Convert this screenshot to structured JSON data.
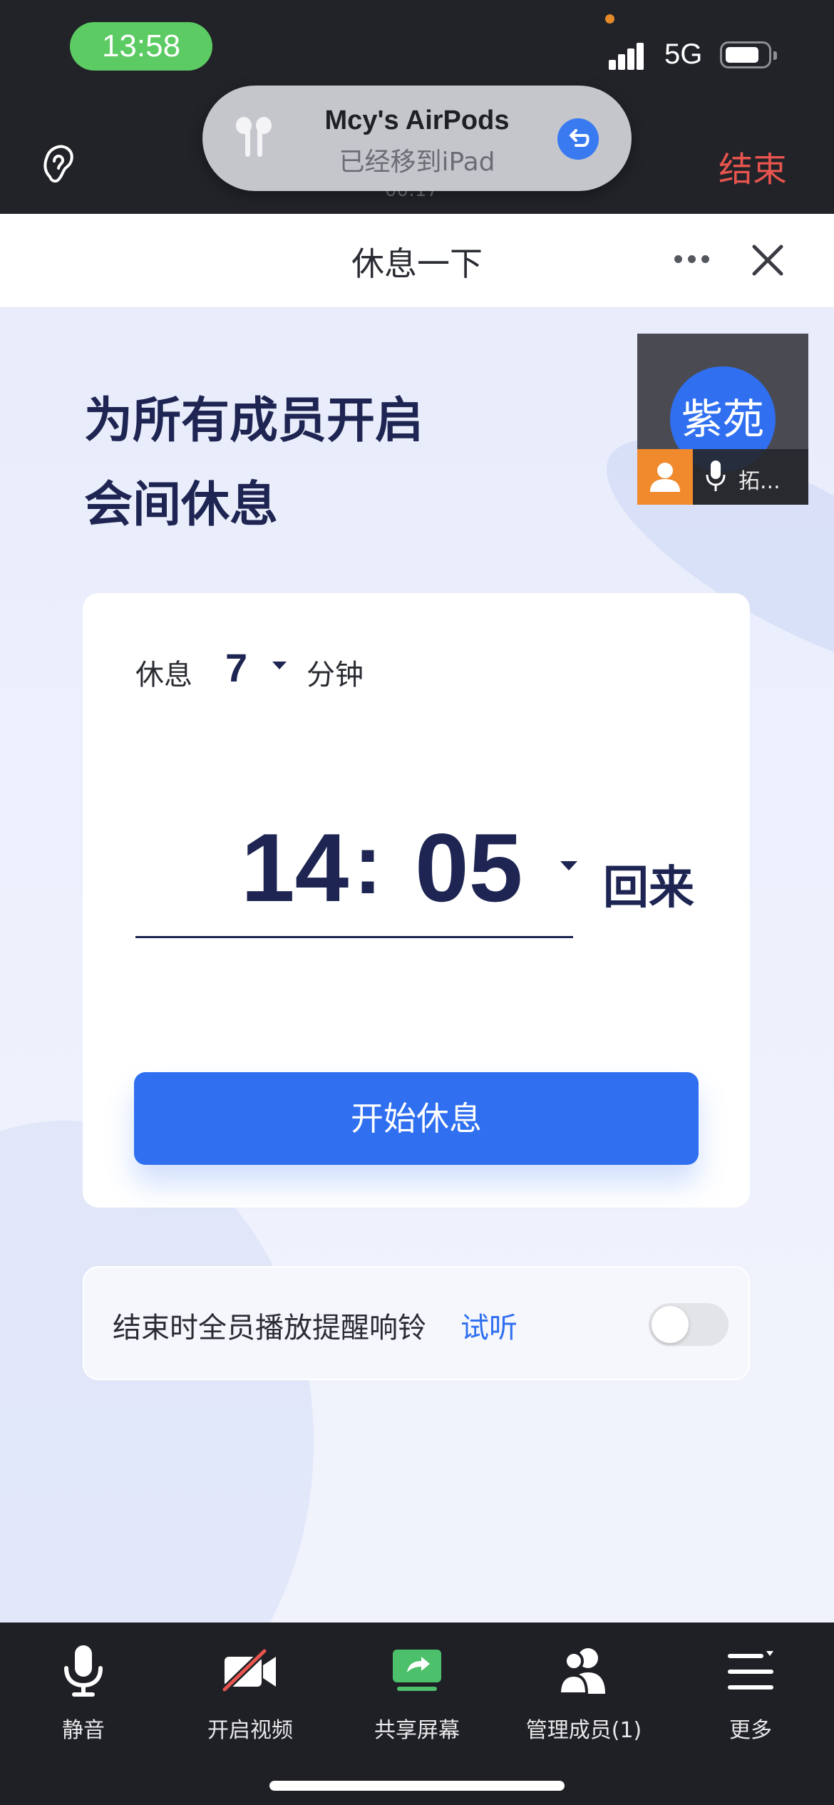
{
  "status_bar": {
    "time": "13:58",
    "network": "5G"
  },
  "call_bar": {
    "end_label": "结束",
    "timer": "00:17"
  },
  "airpods_banner": {
    "title": "Mcy's AirPods",
    "subtitle": "已经移到iPad"
  },
  "sheet": {
    "title": "休息一下"
  },
  "headline": {
    "line1": "为所有成员开启",
    "line2": "会间休息"
  },
  "video_tile": {
    "avatar_text": "紫苑",
    "name": "拓..."
  },
  "break_card": {
    "duration_label": "休息",
    "duration_value": "7",
    "duration_unit": "分钟",
    "return_hour": "14",
    "return_colon": ":",
    "return_minute": "05",
    "return_label": "回来",
    "start_button": "开始休息"
  },
  "bell": {
    "text": "结束时全员播放提醒响铃",
    "listen_label": "试听",
    "enabled": false
  },
  "toolbar": {
    "items": [
      {
        "label": "静音",
        "icon": "microphone-icon"
      },
      {
        "label": "开启视频",
        "icon": "video-off-icon"
      },
      {
        "label": "共享屏幕",
        "icon": "share-screen-icon"
      },
      {
        "label": "管理成员(1)",
        "icon": "members-icon"
      },
      {
        "label": "更多",
        "icon": "more-menu-icon"
      }
    ]
  },
  "colors": {
    "accent": "#2f6ff0",
    "end_red": "#e8544e",
    "share_green": "#4cc06a",
    "time_pill_green": "#5ccb63"
  }
}
